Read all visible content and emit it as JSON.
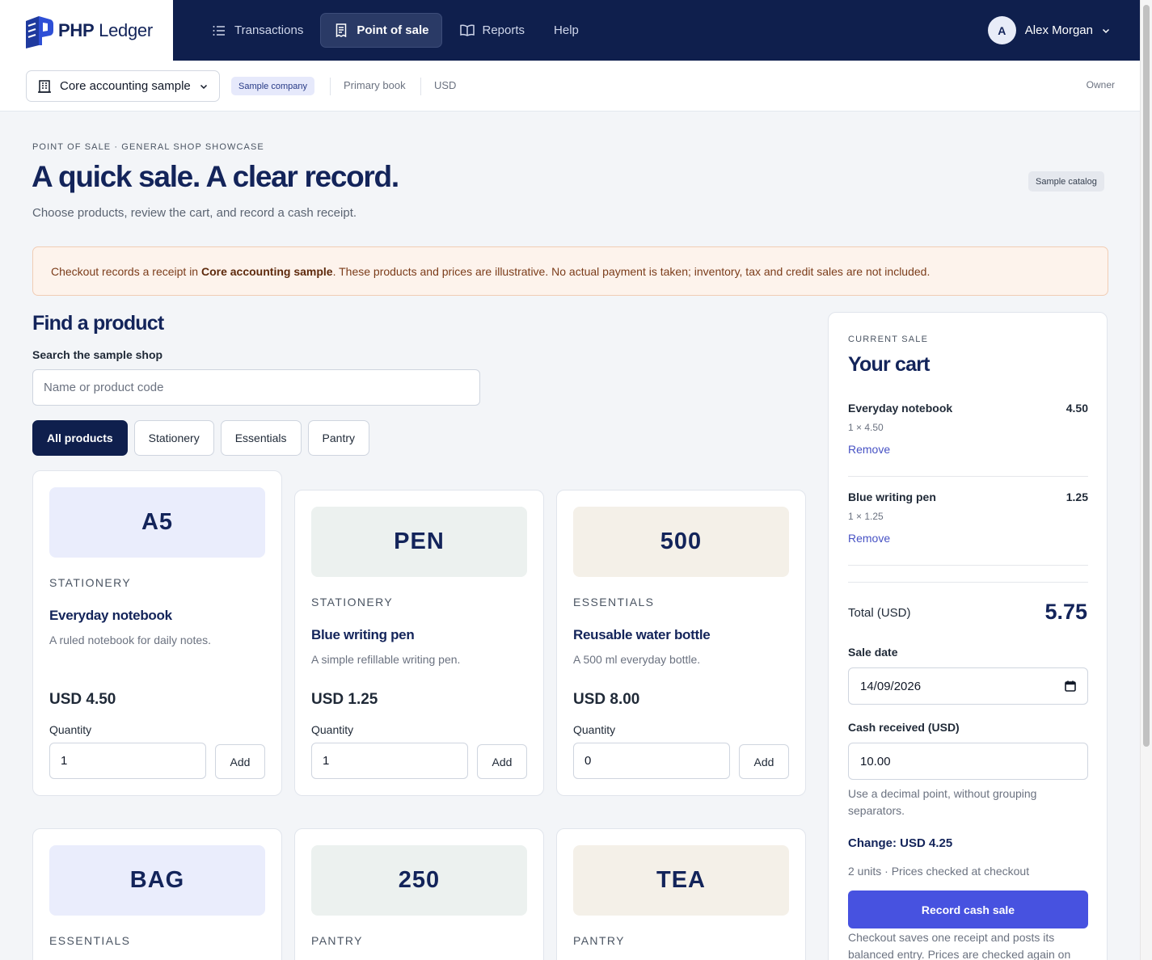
{
  "brand": {
    "name_bold": "PHP",
    "name_rest": " Ledger"
  },
  "nav": [
    {
      "label": "Transactions",
      "icon": "list-icon"
    },
    {
      "label": "Point of sale",
      "icon": "receipt-icon",
      "active": true
    },
    {
      "label": "Reports",
      "icon": "book-icon"
    },
    {
      "label": "Help"
    }
  ],
  "user": {
    "initial": "A",
    "name": "Alex Morgan"
  },
  "subbar": {
    "company": "Core accounting sample",
    "badge": "Sample company",
    "book": "Primary book",
    "currency": "USD",
    "role": "Owner"
  },
  "header": {
    "eyebrow": "POINT OF SALE · GENERAL SHOP SHOWCASE",
    "title": "A quick sale. A clear record.",
    "subtitle": "Choose products, review the cart, and record a cash receipt.",
    "catalog_badge": "Sample catalog"
  },
  "notice": {
    "before": "Checkout records a receipt in ",
    "company": "Core accounting sample",
    "after": ". These products and prices are illustrative. No actual payment is taken; inventory, tax and credit sales are not included."
  },
  "find": {
    "title": "Find a product",
    "search_label": "Search the sample shop",
    "search_placeholder": "Name or product code",
    "search_value": "",
    "filters": [
      "All products",
      "Stationery",
      "Essentials",
      "Pantry"
    ]
  },
  "products": [
    {
      "code": "A5",
      "category": "STATIONERY",
      "name": "Everyday notebook",
      "desc": "A ruled notebook for daily notes.",
      "price": "USD 4.50",
      "qty_label": "Quantity",
      "qty": "1",
      "add": "Add",
      "tint": "#eaedfc"
    },
    {
      "code": "PEN",
      "category": "STATIONERY",
      "name": "Blue writing pen",
      "desc": "A simple refillable writing pen.",
      "price": "USD 1.25",
      "qty_label": "Quantity",
      "qty": "1",
      "add": "Add",
      "tint": "#ecf1ef"
    },
    {
      "code": "500",
      "category": "ESSENTIALS",
      "name": "Reusable water bottle",
      "desc": "A 500 ml everyday bottle.",
      "price": "USD 8.00",
      "qty_label": "Quantity",
      "qty": "0",
      "add": "Add",
      "tint": "#f4f0e8"
    },
    {
      "code": "BAG",
      "category": "ESSENTIALS",
      "tint": "#eaedfc"
    },
    {
      "code": "250",
      "category": "PANTRY",
      "tint": "#ecf1ef"
    },
    {
      "code": "TEA",
      "category": "PANTRY",
      "tint": "#f4f0e8"
    }
  ],
  "cart": {
    "eyebrow": "CURRENT SALE",
    "title": "Your cart",
    "lines": [
      {
        "name": "Everyday notebook",
        "amount": "4.50",
        "qty": "1 × 4.50",
        "remove": "Remove"
      },
      {
        "name": "Blue writing pen",
        "amount": "1.25",
        "qty": "1 × 1.25",
        "remove": "Remove"
      }
    ],
    "total_label": "Total (USD)",
    "total": "5.75",
    "date_label": "Sale date",
    "date": "14/09/2026",
    "cash_label": "Cash received (USD)",
    "cash": "10.00",
    "cash_hint": "Use a decimal point, without grouping separators.",
    "change": "Change: USD 4.25",
    "units": "2 units · Prices checked at checkout",
    "record": "Record cash sale",
    "footnote": "Checkout saves one receipt and posts its balanced entry. Prices are checked again on"
  }
}
